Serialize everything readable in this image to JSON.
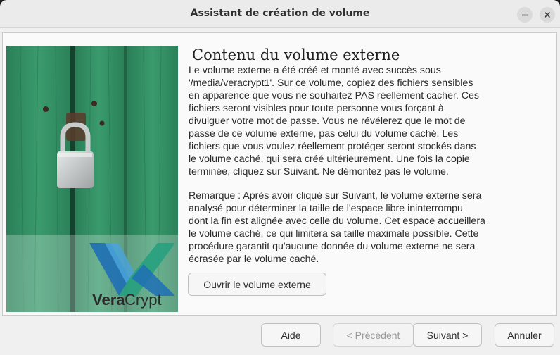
{
  "window": {
    "title": "Assistant de création de volume"
  },
  "main": {
    "heading": "Contenu du volume externe",
    "paragraph1_lines": [
      "Le volume externe a été créé et monté avec succès sous",
      "'/media/veracrypt1'. Sur ce volume, copiez des fichiers sensibles",
      "en apparence que vous ne souhaitez PAS réellement cacher. Ces",
      "fichiers seront visibles pour toute personne vous forçant à",
      "divulguer votre mot de passe. Vous ne révélerez que le mot de",
      "passe de ce volume externe, pas celui du volume caché. Les",
      "fichiers que vous voulez réellement protéger seront stockés dans",
      "le volume caché, qui sera créé ultérieurement. Une fois la copie",
      "terminée, cliquez sur Suivant. Ne démontez pas le volume."
    ],
    "paragraph2_lines": [
      "Remarque : Après avoir cliqué sur Suivant, le volume externe sera",
      "analysé pour déterminer la taille de l'espace libre ininterrompu",
      "dont la fin est alignée avec celle du volume. Cet espace accueillera",
      "le volume caché, ce qui limitera sa taille maximale possible. Cette",
      "procédure garantit qu'aucune donnée du volume externe ne sera",
      "écrasée par le volume caché."
    ],
    "open_outer_label": "Ouvrir le volume externe"
  },
  "image": {
    "logo_text_vera": "Vera",
    "logo_text_crypt": "Crypt"
  },
  "footer": {
    "help_label": "Aide",
    "prev_label": "< Précédent",
    "next_label": "Suivant >",
    "cancel_label": "Annuler"
  },
  "colors": {
    "door_green": "#2f8f63",
    "logo_blue": "#1f6fb5",
    "logo_teal": "#27a07e"
  },
  "icons": {
    "minimize": "minimize-icon",
    "close": "close-icon",
    "padlock": "padlock-icon"
  }
}
